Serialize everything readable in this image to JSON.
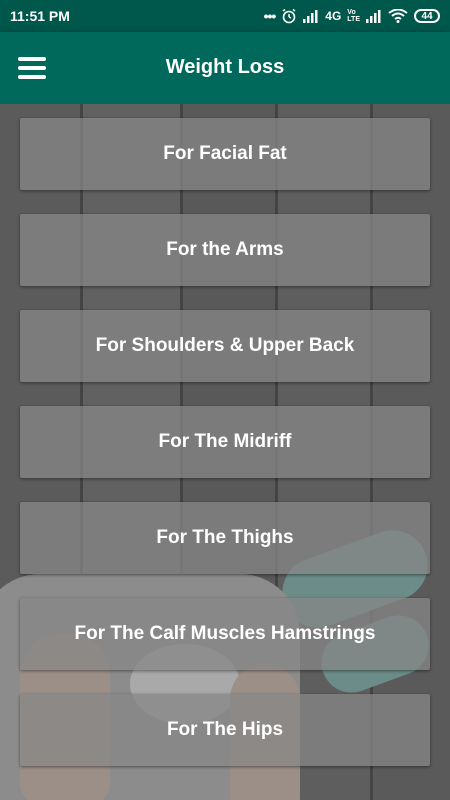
{
  "status_bar": {
    "time": "11:51 PM",
    "network": "4G",
    "carrier_tag_top": "Vo",
    "carrier_tag_bottom": "LTE",
    "battery": "44",
    "icons": [
      "more-dots-icon",
      "alarm-icon",
      "signal-icon",
      "signal-icon",
      "wifi-icon",
      "battery-icon"
    ]
  },
  "appbar": {
    "title": "Weight Loss",
    "menu_icon": "hamburger-menu-icon"
  },
  "colors": {
    "status_bar": "#00574b",
    "app_bar": "#00695c",
    "item_bg": "#878787",
    "text": "#ffffff"
  },
  "items": [
    {
      "label": "For Facial Fat"
    },
    {
      "label": "For the Arms"
    },
    {
      "label": "For Shoulders & Upper Back"
    },
    {
      "label": "For The Midriff"
    },
    {
      "label": "For The Thighs"
    },
    {
      "label": "For The Calf Muscles Hamstrings"
    },
    {
      "label": "For The Hips"
    }
  ]
}
